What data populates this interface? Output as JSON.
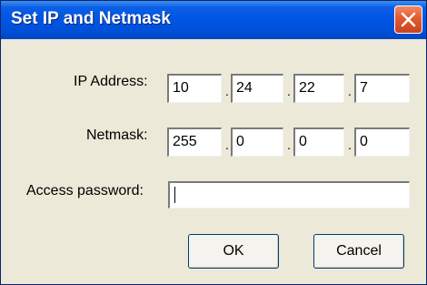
{
  "window": {
    "title": "Set IP and Netmask"
  },
  "ip": {
    "label": "IP Address:",
    "octets": [
      "10",
      "24",
      "22",
      "7"
    ],
    "separator": "."
  },
  "netmask": {
    "label": "Netmask:",
    "octets": [
      "255",
      "0",
      "0",
      "0"
    ],
    "separator": "."
  },
  "password": {
    "label": "Access password:",
    "value": ""
  },
  "buttons": {
    "ok": "OK",
    "cancel": "Cancel"
  },
  "icons": {
    "close": "close-icon"
  },
  "colors": {
    "titlebar": "#0054e3",
    "close_button": "#e2592f",
    "dialog_bg": "#ece9d8"
  }
}
